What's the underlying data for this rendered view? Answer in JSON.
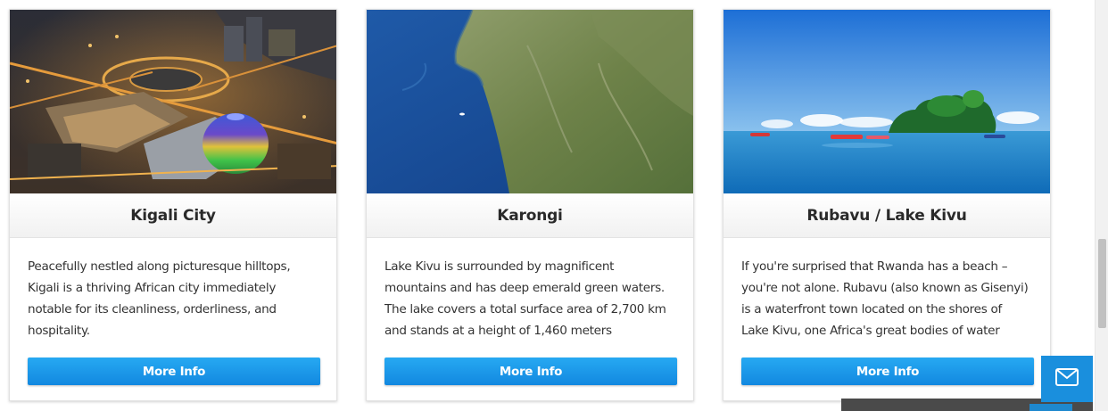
{
  "cards": [
    {
      "title": "Kigali City",
      "description": "Peacefully nestled along picturesque hilltops, Kigali is a thriving African city immediately notable for its cleanliness, orderliness, and hospitality.",
      "button_label": "More Info"
    },
    {
      "title": "Karongi",
      "description": "Lake Kivu is surrounded by magnificent mountains and has deep emerald green waters. The lake covers a total surface area of 2,700 km and stands at a height of 1,460 meters",
      "button_label": "More Info"
    },
    {
      "title": "Rubavu / Lake Kivu",
      "description": "If you're surprised that Rwanda has a beach – you're not alone. Rubavu (also known as Gisenyi) is a waterfront town located on the shores of Lake Kivu, one Africa's great bodies of water",
      "button_label": "More Info"
    }
  ],
  "contact_button": {
    "icon": "envelope-icon"
  },
  "colors": {
    "accent": "#1a8fdd",
    "button": "#1e98e8"
  }
}
